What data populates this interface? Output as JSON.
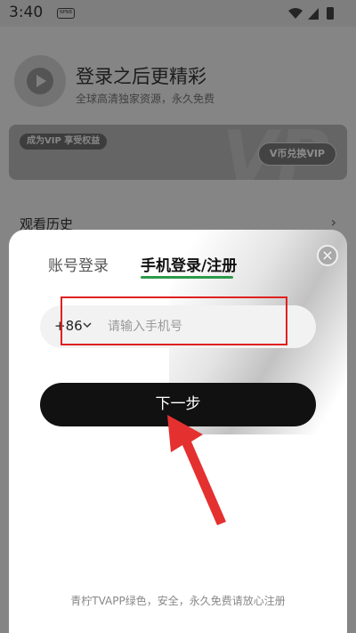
{
  "status_bar": {
    "time": "3:40",
    "badge": "NPNB"
  },
  "profile": {
    "title": "登录之后更精彩",
    "subtitle": "全球高清独家资源，永久免费"
  },
  "vip_banner": {
    "tag": "成为VIP 享受权益",
    "exchange_button": "V币兑换VIP",
    "deco_text": "VP"
  },
  "history": {
    "title": "观看历史"
  },
  "login_modal": {
    "tabs": [
      {
        "label": "账号登录",
        "active": false
      },
      {
        "label": "手机登录/注册",
        "active": true
      }
    ],
    "country_code": "+86",
    "phone_placeholder": "请输入手机号",
    "next_button": "下一步",
    "footer_note": "青柠TVAPP绿色，安全，永久免费请放心注册",
    "close_icon": "×"
  },
  "colors": {
    "accent_green": "#2c9a4a",
    "highlight_red": "#e02020",
    "button_black": "#111111"
  }
}
